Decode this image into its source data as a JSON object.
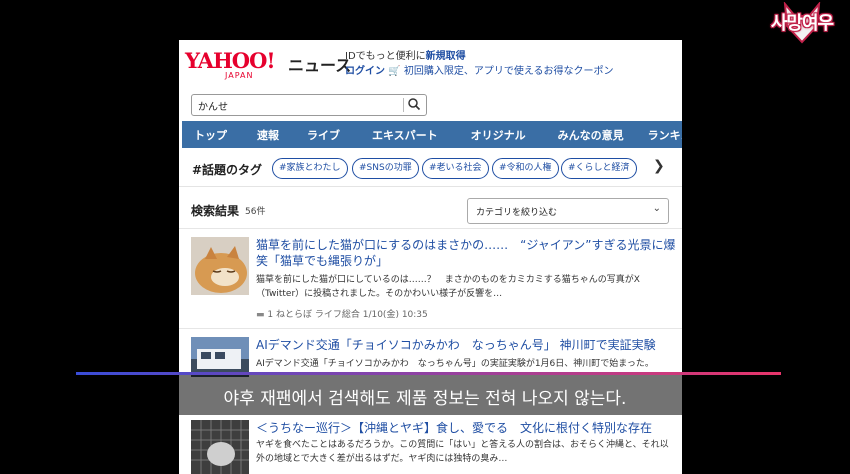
{
  "channel_logo": {
    "text": "사망여우"
  },
  "header": {
    "logo": "YAHOO!",
    "logo_sub": "JAPAN",
    "site_name": "ニュース",
    "promo_line1_prefix": "IDでもっと便利に",
    "promo_line1_link": "新規取得",
    "promo_line2_login": "ログイン",
    "promo_line2_text": "初回購入限定、アプリで使えるお得なクーポン",
    "cart_icon": "cart-icon"
  },
  "search": {
    "query": "かんせ",
    "icon": "search-icon"
  },
  "nav": {
    "items": [
      "トップ",
      "速報",
      "ライブ",
      "エキスパート",
      "オリジナル",
      "みんなの意見",
      "ランキング"
    ]
  },
  "tags": {
    "heading": "#話題のタグ",
    "items": [
      "#家族とわたし",
      "#SNSの功罪",
      "#老いる社会",
      "#令和の人権",
      "#くらしと経済"
    ],
    "next_icon": "chevron-right-icon"
  },
  "results": {
    "title": "検索結果",
    "count": "56件",
    "filter_label": "カテゴリを絞り込む",
    "filter_icon": "chevron-down-icon"
  },
  "articles": [
    {
      "headline": "猫草を前にした猫が口にするのはまさかの……　“ジャイアン”すぎる光景に爆笑「猫草でも縄張りが」",
      "snippet": "猫草を前にした猫が口にしているのは……？　まさかのものをカミカミする猫ちゃんの写真がX（Twitter）に投稿されました。そのかわいい様子が反響を…",
      "comments": "1",
      "meta": "ねとらぼ ライフ総合 1/10(金) 10:35",
      "thumb": "cat-photo"
    },
    {
      "headline": "AIデマンド交通「チョイソコかみかわ　なっちゃん号」 神川町で実証実験",
      "snippet": "AIデマンド交通「チョイソコかみかわ　なっちゃん号」の実証実験が1月6日、神川町で始まった。",
      "thumb": "bus-photo"
    },
    {
      "headline": "＜うちなー巡行＞【沖縄とヤギ】食し、愛でる　文化に根付く特別な存在",
      "snippet": "ヤギを食べたことはあるだろうか。この質問に「はい」と答える人の割合は、おそらく沖縄と、それ以外の地域とで大きく差が出るはずだ。ヤギ肉には独特の臭み…",
      "thumb": "goat-photo"
    }
  ],
  "subtitle": "야후 재팬에서 검색해도 제품 정보는 전혀 나오지 않는다."
}
